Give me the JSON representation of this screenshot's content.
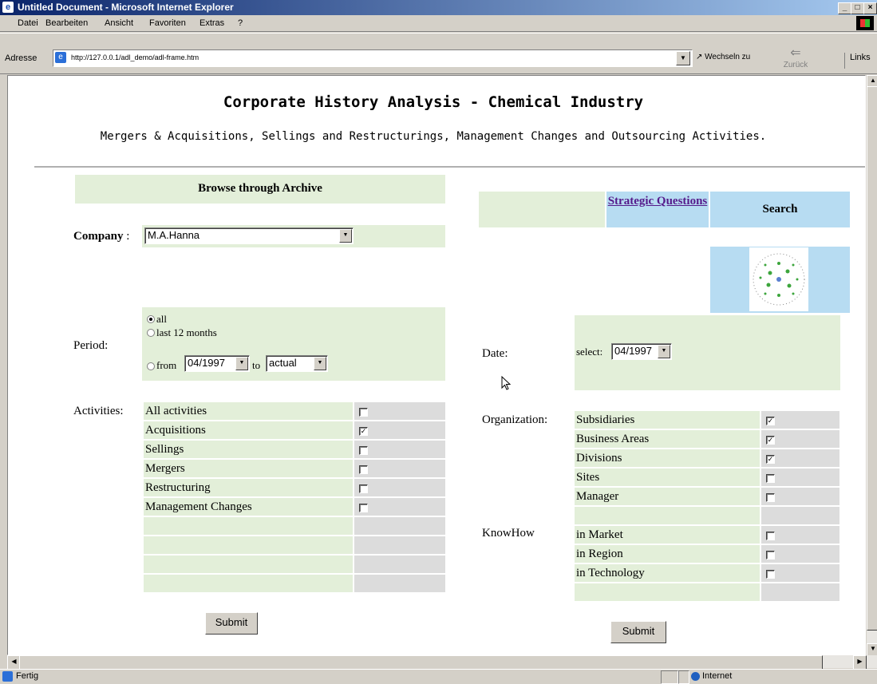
{
  "window": {
    "title": "Untitled Document - Microsoft Internet Explorer"
  },
  "menu": [
    "Datei",
    "Bearbeiten",
    "Ansicht",
    "Favoriten",
    "Extras",
    "?"
  ],
  "address": {
    "label": "Adresse",
    "url": "http://127.0.0.1/adl_demo/adl-frame.htm",
    "go_label": "Wechseln zu",
    "back_label": "Zurück",
    "links_label": "Links"
  },
  "page": {
    "title": "Corporate History Analysis - Chemical Industry",
    "subtitle": "Mergers & Acquisitions, Sellings and Restructurings, Management Changes and Outsourcing Activities."
  },
  "browse": {
    "header": "Browse through Archive",
    "company_label": "Company",
    "company_sep": " :",
    "company_value": "M.A.Hanna",
    "period_label": "Period:",
    "period_all": "all",
    "period_last": "last 12 months",
    "period_from": "from",
    "period_from_value": "04/1997",
    "period_to": "to",
    "period_to_value": "actual",
    "activities_label": "Activities:",
    "activities": [
      {
        "label": "All activities",
        "checked": false
      },
      {
        "label": "Acquisitions",
        "checked": true
      },
      {
        "label": "Sellings",
        "checked": false
      },
      {
        "label": "Mergers",
        "checked": false
      },
      {
        "label": "Restructuring",
        "checked": false
      },
      {
        "label": "Management Changes",
        "checked": false
      }
    ],
    "submit": "Submit"
  },
  "search": {
    "tab_strategic": "Strategic Questions",
    "tab_search": "Search",
    "date_label": "Date:",
    "select_label": "select:",
    "select_value": "04/1997",
    "organization_label": "Organization:",
    "organization": [
      {
        "label": "Subsidiaries",
        "checked": true
      },
      {
        "label": "Business Areas",
        "checked": true
      },
      {
        "label": "Divisions",
        "checked": true
      },
      {
        "label": "Sites",
        "checked": false
      },
      {
        "label": "Manager",
        "checked": false
      }
    ],
    "knowhow_label": "KnowHow",
    "knowhow": [
      {
        "label": "in Market",
        "checked": false
      },
      {
        "label": "in Region",
        "checked": false
      },
      {
        "label": "in Technology",
        "checked": false
      }
    ],
    "submit": "Submit"
  },
  "status": {
    "text": "Fertig",
    "zone": "Internet"
  }
}
